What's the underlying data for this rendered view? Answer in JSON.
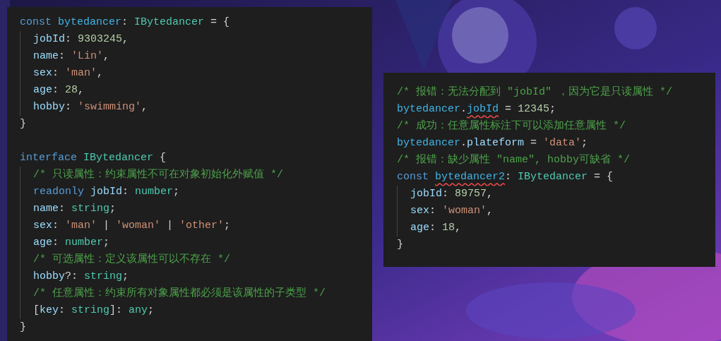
{
  "panels": [
    {
      "blocks": [
        {
          "tokens": [
            {
              "text": "const ",
              "kind": "keyword"
            },
            {
              "text": "bytedancer",
              "kind": "variable"
            },
            {
              "text": ": ",
              "kind": "punct"
            },
            {
              "text": "IBytedancer",
              "kind": "type"
            },
            {
              "text": " = {",
              "kind": "punct"
            }
          ],
          "children": [
            {
              "tokens": [
                {
                  "text": "jobId",
                  "kind": "property"
                },
                {
                  "text": ": ",
                  "kind": "punct"
                },
                {
                  "text": "9303245",
                  "kind": "number"
                },
                {
                  "text": ",",
                  "kind": "punct"
                }
              ]
            },
            {
              "tokens": [
                {
                  "text": "name",
                  "kind": "property"
                },
                {
                  "text": ": ",
                  "kind": "punct"
                },
                {
                  "text": "'Lin'",
                  "kind": "string"
                },
                {
                  "text": ",",
                  "kind": "punct"
                }
              ]
            },
            {
              "tokens": [
                {
                  "text": "sex",
                  "kind": "property"
                },
                {
                  "text": ": ",
                  "kind": "punct"
                },
                {
                  "text": "'man'",
                  "kind": "string"
                },
                {
                  "text": ",",
                  "kind": "punct"
                }
              ]
            },
            {
              "tokens": [
                {
                  "text": "age",
                  "kind": "property"
                },
                {
                  "text": ": ",
                  "kind": "punct"
                },
                {
                  "text": "28",
                  "kind": "number"
                },
                {
                  "text": ",",
                  "kind": "punct"
                }
              ]
            },
            {
              "tokens": [
                {
                  "text": "hobby",
                  "kind": "property"
                },
                {
                  "text": ": ",
                  "kind": "punct"
                },
                {
                  "text": "'swimming'",
                  "kind": "string"
                },
                {
                  "text": ",",
                  "kind": "punct"
                }
              ]
            }
          ],
          "closing": "}"
        },
        {
          "tokens": [
            {
              "text": "interface ",
              "kind": "keyword"
            },
            {
              "text": "IBytedancer",
              "kind": "type"
            },
            {
              "text": " {",
              "kind": "punct"
            }
          ],
          "children": [
            {
              "tokens": [
                {
                  "text": "/* 只读属性：约束属性不可在对象初始化外赋值 */",
                  "kind": "comment"
                }
              ]
            },
            {
              "tokens": [
                {
                  "text": "readonly ",
                  "kind": "keyword"
                },
                {
                  "text": "jobId",
                  "kind": "property"
                },
                {
                  "text": ": ",
                  "kind": "punct"
                },
                {
                  "text": "number",
                  "kind": "type"
                },
                {
                  "text": ";",
                  "kind": "punct"
                }
              ]
            },
            {
              "tokens": [
                {
                  "text": "name",
                  "kind": "property"
                },
                {
                  "text": ": ",
                  "kind": "punct"
                },
                {
                  "text": "string",
                  "kind": "type"
                },
                {
                  "text": ";",
                  "kind": "punct"
                }
              ]
            },
            {
              "tokens": [
                {
                  "text": "sex",
                  "kind": "property"
                },
                {
                  "text": ": ",
                  "kind": "punct"
                },
                {
                  "text": "'man'",
                  "kind": "string"
                },
                {
                  "text": " | ",
                  "kind": "punct"
                },
                {
                  "text": "'woman'",
                  "kind": "string"
                },
                {
                  "text": " | ",
                  "kind": "punct"
                },
                {
                  "text": "'other'",
                  "kind": "string"
                },
                {
                  "text": ";",
                  "kind": "punct"
                }
              ]
            },
            {
              "tokens": [
                {
                  "text": "age",
                  "kind": "property"
                },
                {
                  "text": ": ",
                  "kind": "punct"
                },
                {
                  "text": "number",
                  "kind": "type"
                },
                {
                  "text": ";",
                  "kind": "punct"
                }
              ]
            },
            {
              "tokens": [
                {
                  "text": "/* 可选属性：定义该属性可以不存在 */",
                  "kind": "comment"
                }
              ]
            },
            {
              "tokens": [
                {
                  "text": "hobby",
                  "kind": "property"
                },
                {
                  "text": "?: ",
                  "kind": "punct"
                },
                {
                  "text": "string",
                  "kind": "type"
                },
                {
                  "text": ";",
                  "kind": "punct"
                }
              ]
            },
            {
              "tokens": [
                {
                  "text": "/* 任意属性：约束所有对象属性都必须是该属性的子类型 */",
                  "kind": "comment"
                }
              ]
            },
            {
              "tokens": [
                {
                  "text": "[",
                  "kind": "punct"
                },
                {
                  "text": "key",
                  "kind": "property"
                },
                {
                  "text": ": ",
                  "kind": "punct"
                },
                {
                  "text": "string",
                  "kind": "type"
                },
                {
                  "text": "]: ",
                  "kind": "punct"
                },
                {
                  "text": "any",
                  "kind": "type"
                },
                {
                  "text": ";",
                  "kind": "punct"
                }
              ]
            }
          ],
          "closing": "}"
        }
      ]
    },
    {
      "blocks": [
        {
          "tokens": [
            {
              "text": "/* 报错：无法分配到 \"jobId\" ，因为它是只读属性 */",
              "kind": "comment"
            }
          ]
        },
        {
          "tokens": [
            {
              "text": "bytedancer",
              "kind": "variable"
            },
            {
              "text": ".",
              "kind": "punct"
            },
            {
              "text": "jobId",
              "kind": "variable",
              "error": true
            },
            {
              "text": " = ",
              "kind": "punct"
            },
            {
              "text": "12345",
              "kind": "number"
            },
            {
              "text": ";",
              "kind": "punct"
            }
          ]
        },
        {
          "tokens": [
            {
              "text": "/* 成功：任意属性标注下可以添加任意属性 */",
              "kind": "comment"
            }
          ]
        },
        {
          "tokens": [
            {
              "text": "bytedancer",
              "kind": "variable"
            },
            {
              "text": ".",
              "kind": "punct"
            },
            {
              "text": "plateform",
              "kind": "property"
            },
            {
              "text": " = ",
              "kind": "punct"
            },
            {
              "text": "'data'",
              "kind": "string"
            },
            {
              "text": ";",
              "kind": "punct"
            }
          ]
        },
        {
          "tokens": [
            {
              "text": "/* 报错：缺少属性 \"name\", hobby可缺省 */",
              "kind": "comment"
            }
          ]
        },
        {
          "tokens": [
            {
              "text": "const ",
              "kind": "keyword"
            },
            {
              "text": "bytedancer2",
              "kind": "variable",
              "error": true
            },
            {
              "text": ": ",
              "kind": "punct"
            },
            {
              "text": "IBytedancer",
              "kind": "type"
            },
            {
              "text": " = {",
              "kind": "punct"
            }
          ],
          "children": [
            {
              "tokens": [
                {
                  "text": "jobId",
                  "kind": "property"
                },
                {
                  "text": ": ",
                  "kind": "punct"
                },
                {
                  "text": "89757",
                  "kind": "number"
                },
                {
                  "text": ",",
                  "kind": "punct"
                }
              ]
            },
            {
              "tokens": [
                {
                  "text": "sex",
                  "kind": "property"
                },
                {
                  "text": ": ",
                  "kind": "punct"
                },
                {
                  "text": "'woman'",
                  "kind": "string"
                },
                {
                  "text": ",",
                  "kind": "punct"
                }
              ]
            },
            {
              "tokens": [
                {
                  "text": "age",
                  "kind": "property"
                },
                {
                  "text": ": ",
                  "kind": "punct"
                },
                {
                  "text": "18",
                  "kind": "number"
                },
                {
                  "text": ",",
                  "kind": "punct"
                }
              ]
            }
          ],
          "closing": "}"
        }
      ]
    }
  ]
}
